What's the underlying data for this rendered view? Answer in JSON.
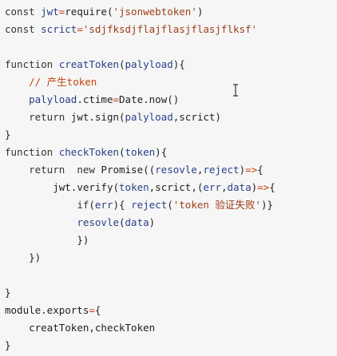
{
  "editor": {
    "lines": [
      [
        {
          "t": "const ",
          "c": "kw"
        },
        {
          "t": "jwt",
          "c": "var"
        },
        {
          "t": "=",
          "c": "op"
        },
        {
          "t": "require(",
          "c": "plain"
        },
        {
          "t": "'jsonwebtoken'",
          "c": "str"
        },
        {
          "t": ")",
          "c": "plain"
        }
      ],
      [
        {
          "t": "const ",
          "c": "kw"
        },
        {
          "t": "scrict",
          "c": "var"
        },
        {
          "t": "=",
          "c": "op"
        },
        {
          "t": "'sdjfksdjflajflasjflasjflksf'",
          "c": "str"
        }
      ],
      [],
      [
        {
          "t": "function ",
          "c": "kw"
        },
        {
          "t": "creatToken",
          "c": "fn"
        },
        {
          "t": "(",
          "c": "plain"
        },
        {
          "t": "palyload",
          "c": "var"
        },
        {
          "t": "){",
          "c": "plain"
        }
      ],
      [
        {
          "t": "    ",
          "c": "plain"
        },
        {
          "t": "// 产生token",
          "c": "cm"
        }
      ],
      [
        {
          "t": "    ",
          "c": "plain"
        },
        {
          "t": "palyload",
          "c": "var"
        },
        {
          "t": ".ctime",
          "c": "plain"
        },
        {
          "t": "=",
          "c": "op"
        },
        {
          "t": "Date.now()",
          "c": "plain"
        }
      ],
      [
        {
          "t": "    ",
          "c": "plain"
        },
        {
          "t": "return ",
          "c": "kw"
        },
        {
          "t": "jwt.sign(",
          "c": "plain"
        },
        {
          "t": "palyload",
          "c": "var"
        },
        {
          "t": ",scrict)",
          "c": "plain"
        }
      ],
      [
        {
          "t": "}",
          "c": "plain"
        }
      ],
      [
        {
          "t": "function ",
          "c": "kw"
        },
        {
          "t": "checkToken",
          "c": "fn"
        },
        {
          "t": "(",
          "c": "plain"
        },
        {
          "t": "token",
          "c": "var"
        },
        {
          "t": "){",
          "c": "plain"
        }
      ],
      [
        {
          "t": "    ",
          "c": "plain"
        },
        {
          "t": "return  new ",
          "c": "kw"
        },
        {
          "t": "Promise((",
          "c": "plain"
        },
        {
          "t": "resovle",
          "c": "var"
        },
        {
          "t": ",",
          "c": "plain"
        },
        {
          "t": "reject",
          "c": "var"
        },
        {
          "t": ")",
          "c": "plain"
        },
        {
          "t": "=>",
          "c": "op"
        },
        {
          "t": "{",
          "c": "plain"
        }
      ],
      [
        {
          "t": "        ",
          "c": "plain"
        },
        {
          "t": "jwt.verify(",
          "c": "plain"
        },
        {
          "t": "token",
          "c": "var"
        },
        {
          "t": ",scrict,(",
          "c": "plain"
        },
        {
          "t": "err",
          "c": "var"
        },
        {
          "t": ",",
          "c": "plain"
        },
        {
          "t": "data",
          "c": "var"
        },
        {
          "t": ")",
          "c": "plain"
        },
        {
          "t": "=>",
          "c": "op"
        },
        {
          "t": "{",
          "c": "plain"
        }
      ],
      [
        {
          "t": "            ",
          "c": "plain"
        },
        {
          "t": "if",
          "c": "kw"
        },
        {
          "t": "(",
          "c": "plain"
        },
        {
          "t": "err",
          "c": "var"
        },
        {
          "t": "){ ",
          "c": "plain"
        },
        {
          "t": "reject",
          "c": "var"
        },
        {
          "t": "(",
          "c": "plain"
        },
        {
          "t": "'token 验证失败'",
          "c": "str"
        },
        {
          "t": ")}",
          "c": "plain"
        }
      ],
      [
        {
          "t": "            ",
          "c": "plain"
        },
        {
          "t": "resovle",
          "c": "var"
        },
        {
          "t": "(",
          "c": "plain"
        },
        {
          "t": "data",
          "c": "var"
        },
        {
          "t": ")",
          "c": "plain"
        }
      ],
      [
        {
          "t": "            ",
          "c": "plain"
        },
        {
          "t": "})",
          "c": "plain"
        }
      ],
      [
        {
          "t": "    ",
          "c": "plain"
        },
        {
          "t": "})",
          "c": "plain"
        }
      ],
      [],
      [
        {
          "t": "}",
          "c": "plain"
        }
      ],
      [
        {
          "t": "module.exports",
          "c": "plain"
        },
        {
          "t": "=",
          "c": "op"
        },
        {
          "t": "{",
          "c": "plain"
        }
      ],
      [
        {
          "t": "    ",
          "c": "plain"
        },
        {
          "t": "creatToken,checkToken",
          "c": "plain"
        }
      ],
      [
        {
          "t": "}",
          "c": "plain"
        }
      ]
    ],
    "cursor_icon": "text-cursor-icon"
  }
}
